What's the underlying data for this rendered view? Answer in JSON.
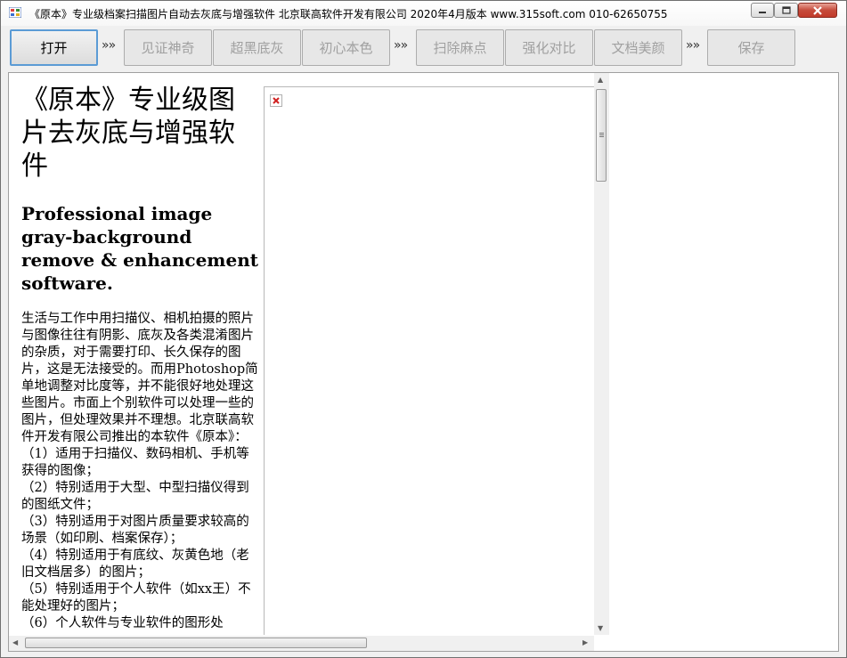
{
  "window": {
    "title": "《原本》专业级档案扫描图片自动去灰底与增强软件 北京联高软件开发有限公司 2020年4月版本 www.315soft.com 010-62650755"
  },
  "toolbar": {
    "open_label": "打开",
    "sep": "»»",
    "steps": [
      "见证神奇",
      "超黑底灰",
      "初心本色",
      "扫除麻点",
      "强化对比",
      "文档美颜",
      "保存"
    ]
  },
  "document": {
    "title_cn": "《原本》专业级图片去灰底与增强软件",
    "title_en": "Professional image gray-background remove & enhancement software.",
    "intro": "生活与工作中用扫描仪、相机拍摄的照片与图像往往有阴影、底灰及各类混淆图片的杂质，对于需要打印、长久保存的图片，这是无法接受的。而用Photoshop简单地调整对比度等，并不能很好地处理这些图片。市面上个别软件可以处理一些的图片，但处理效果并不理想。北京联高软件开发有限公司推出的本软件《原本》：",
    "items": [
      "（1）适用于扫描仪、数码相机、手机等获得的图像；",
      "（2）特别适用于大型、中型扫描仪得到的图纸文件；",
      "（3）特别适用于对图片质量要求较高的场景（如印刷、档案保存）；",
      "（4）特别适用于有底纹、灰黄色地（老旧文档居多）的图片；",
      "（5）特别适用于个人软件（如xx王）不能处理好的图片；",
      "（6）个人软件与专业软件的图形处"
    ]
  },
  "colors": {
    "active_border": "#5b9bd5",
    "disabled_text": "#a0a0a0",
    "close_red": "#c64b3b"
  }
}
